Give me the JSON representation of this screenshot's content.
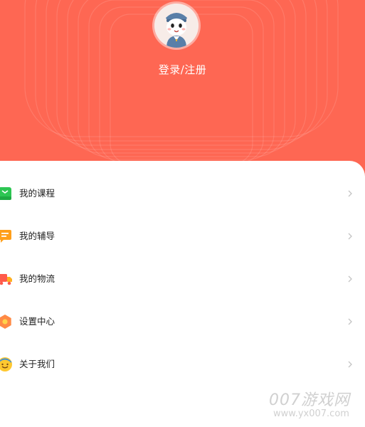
{
  "header": {
    "background_color": "#fe6753",
    "avatar_icon": "mascot-avatar",
    "login_label": "登录/注册"
  },
  "menu": {
    "items": [
      {
        "label": "我的课程",
        "icon": "book-icon",
        "icon_color": "#2dc653"
      },
      {
        "label": "我的辅导",
        "icon": "chat-bubble-icon",
        "icon_color": "#ff9f1a"
      },
      {
        "label": "我的物流",
        "icon": "truck-icon",
        "icon_color": "#ff5a4a"
      },
      {
        "label": "设置中心",
        "icon": "gear-icon",
        "icon_color": "#ff8a45"
      },
      {
        "label": "关于我们",
        "icon": "smiley-icon",
        "icon_color": "#ffc830"
      }
    ]
  },
  "watermark": {
    "brand": "007游戏网",
    "url": "www.yx007.com"
  }
}
